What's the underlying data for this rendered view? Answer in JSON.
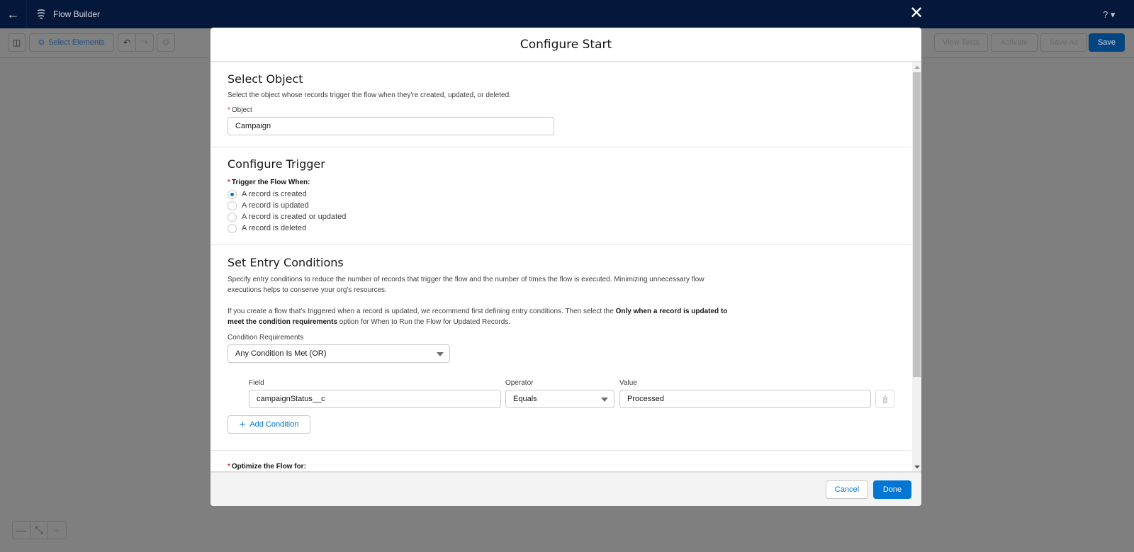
{
  "app": {
    "title": "Flow Builder",
    "help_label": "? ▾"
  },
  "toolbar": {
    "select_elements_label": "Select Elements",
    "view_tests_label": "View Tests",
    "activate_label": "Activate",
    "save_as_label": "Save As",
    "save_label": "Save"
  },
  "zoom_controls": {
    "zoom_out": "—",
    "fit": "⤡",
    "zoom_in": "+"
  },
  "modal": {
    "title": "Configure Start",
    "select_object": {
      "title": "Select Object",
      "description": "Select the object whose records trigger the flow when they're created, updated, or deleted.",
      "object_label": "Object",
      "object_value": "Campaign"
    },
    "configure_trigger": {
      "title": "Configure Trigger",
      "trigger_label": "Trigger the Flow When:",
      "options": [
        {
          "label": "A record is created",
          "checked": true
        },
        {
          "label": "A record is updated",
          "checked": false
        },
        {
          "label": "A record is created or updated",
          "checked": false
        },
        {
          "label": "A record is deleted",
          "checked": false
        }
      ]
    },
    "entry_conditions": {
      "title": "Set Entry Conditions",
      "description1": "Specify entry conditions to reduce the number of records that trigger the flow and the number of times the flow is executed. Minimizing unnecessary flow executions helps to conserve your org's resources.",
      "description2_pre": "If you create a flow that's triggered when a record is updated, we recommend first defining entry conditions. Then select the ",
      "description2_bold": "Only when a record is updated to meet the condition requirements",
      "description2_post": " option for When to Run the Flow for Updated Records.",
      "requirements_label": "Condition Requirements",
      "requirements_value": "Any Condition Is Met (OR)",
      "condition": {
        "field_label": "Field",
        "field_value": "campaignStatus__c",
        "operator_label": "Operator",
        "operator_value": "Equals",
        "value_label": "Value",
        "value_value": "Processed"
      },
      "add_condition_label": "Add Condition"
    },
    "optimize_label": "Optimize the Flow for:",
    "cancel_label": "Cancel",
    "done_label": "Done"
  },
  "colors": {
    "brand": "#0176d3",
    "header_bg": "#03183a",
    "required": "#c23934"
  }
}
